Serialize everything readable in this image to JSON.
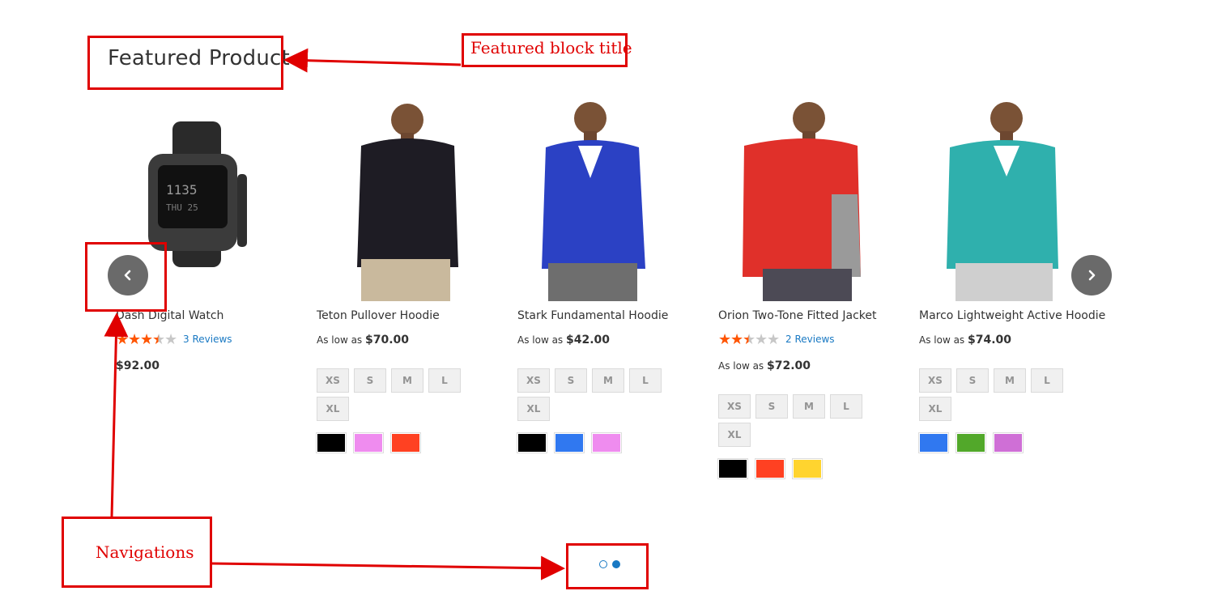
{
  "block": {
    "title": "Featured Product"
  },
  "annotations": {
    "title_label": "Featured block title",
    "nav_label": "Navigations"
  },
  "products": [
    {
      "name": "Dash Digital Watch",
      "rating_stars": 3.5,
      "reviews": "3 Reviews",
      "price_prefix": "",
      "price": "$92.00",
      "sizes": [],
      "swatches": [],
      "image": "watch"
    },
    {
      "name": "Teton Pullover Hoodie",
      "rating_stars": null,
      "reviews": "",
      "price_prefix": "As low as",
      "price": "$70.00",
      "sizes": [
        "XS",
        "S",
        "M",
        "L",
        "XL"
      ],
      "swatches": [
        "#000000",
        "#ef8cef",
        "#ff4122"
      ],
      "image": "hoodie-black"
    },
    {
      "name": "Stark Fundamental Hoodie",
      "rating_stars": null,
      "reviews": "",
      "price_prefix": "As low as",
      "price": "$42.00",
      "sizes": [
        "XS",
        "S",
        "M",
        "L",
        "XL"
      ],
      "swatches": [
        "#000000",
        "#3078f0",
        "#ef8cef"
      ],
      "image": "hoodie-blue"
    },
    {
      "name": "Orion Two-Tone Fitted Jacket",
      "rating_stars": 2.5,
      "reviews": "2 Reviews",
      "price_prefix": "As low as",
      "price": "$72.00",
      "sizes": [
        "XS",
        "S",
        "M",
        "L",
        "XL"
      ],
      "swatches": [
        "#000000",
        "#ff4122",
        "#ffd42f"
      ],
      "image": "jacket-red"
    },
    {
      "name": "Marco Lightweight Active Hoodie",
      "rating_stars": null,
      "reviews": "",
      "price_prefix": "As low as",
      "price": "$74.00",
      "sizes": [
        "XS",
        "S",
        "M",
        "L",
        "XL"
      ],
      "swatches": [
        "#3078f0",
        "#52a82a",
        "#cf6fd6"
      ],
      "image": "hoodie-teal"
    }
  ],
  "pagination": {
    "pages": 2,
    "active_page": 2
  },
  "colors": {
    "accent": "#1979c3",
    "annotation": "#e00000",
    "star": "#ff5501"
  }
}
